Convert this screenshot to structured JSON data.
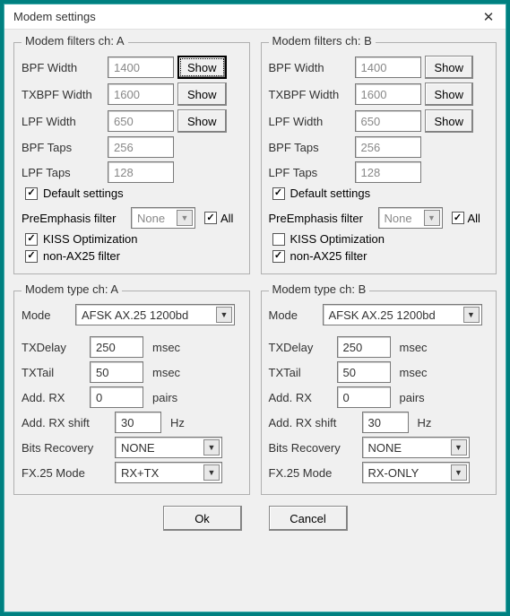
{
  "window": {
    "title": "Modem settings"
  },
  "filtersA": {
    "legend": "Modem filters ch: A",
    "bpf_width_label": "BPF Width",
    "bpf_width": "1400",
    "show1": "Show",
    "txbpf_width_label": "TXBPF Width",
    "txbpf_width": "1600",
    "show2": "Show",
    "lpf_width_label": "LPF Width",
    "lpf_width": "650",
    "show3": "Show",
    "bpf_taps_label": "BPF Taps",
    "bpf_taps": "256",
    "lpf_taps_label": "LPF Taps",
    "lpf_taps": "128",
    "default_label": "Default settings",
    "default_checked": true,
    "preemph_label": "PreEmphasis filter",
    "preemph_value": "None",
    "all_label": "All",
    "all_checked": true,
    "kiss_label": "KISS Optimization",
    "kiss_checked": true,
    "nonax25_label": "non-AX25 filter",
    "nonax25_checked": true
  },
  "filtersB": {
    "legend": "Modem filters ch: B",
    "bpf_width_label": "BPF Width",
    "bpf_width": "1400",
    "show1": "Show",
    "txbpf_width_label": "TXBPF Width",
    "txbpf_width": "1600",
    "show2": "Show",
    "lpf_width_label": "LPF Width",
    "lpf_width": "650",
    "show3": "Show",
    "bpf_taps_label": "BPF Taps",
    "bpf_taps": "256",
    "lpf_taps_label": "LPF Taps",
    "lpf_taps": "128",
    "default_label": "Default settings",
    "default_checked": true,
    "preemph_label": "PreEmphasis filter",
    "preemph_value": "None",
    "all_label": "All",
    "all_checked": true,
    "kiss_label": "KISS Optimization",
    "kiss_checked": false,
    "nonax25_label": "non-AX25 filter",
    "nonax25_checked": true
  },
  "typeA": {
    "legend": "Modem type ch: A",
    "mode_label": "Mode",
    "mode_value": "AFSK AX.25 1200bd",
    "txdelay_label": "TXDelay",
    "txdelay": "250",
    "msec": "msec",
    "txtail_label": "TXTail",
    "txtail": "50",
    "addrx_label": "Add. RX",
    "addrx": "0",
    "pairs": "pairs",
    "addrxshift_label": "Add. RX shift",
    "addrxshift": "30",
    "hz": "Hz",
    "bitsrec_label": "Bits Recovery",
    "bitsrec_value": "NONE",
    "fx25_label": "FX.25 Mode",
    "fx25_value": "RX+TX"
  },
  "typeB": {
    "legend": "Modem type ch: B",
    "mode_label": "Mode",
    "mode_value": "AFSK AX.25 1200bd",
    "txdelay_label": "TXDelay",
    "txdelay": "250",
    "msec": "msec",
    "txtail_label": "TXTail",
    "txtail": "50",
    "addrx_label": "Add. RX",
    "addrx": "0",
    "pairs": "pairs",
    "addrxshift_label": "Add. RX shift",
    "addrxshift": "30",
    "hz": "Hz",
    "bitsrec_label": "Bits Recovery",
    "bitsrec_value": "NONE",
    "fx25_label": "FX.25 Mode",
    "fx25_value": "RX-ONLY"
  },
  "buttons": {
    "ok": "Ok",
    "cancel": "Cancel"
  }
}
